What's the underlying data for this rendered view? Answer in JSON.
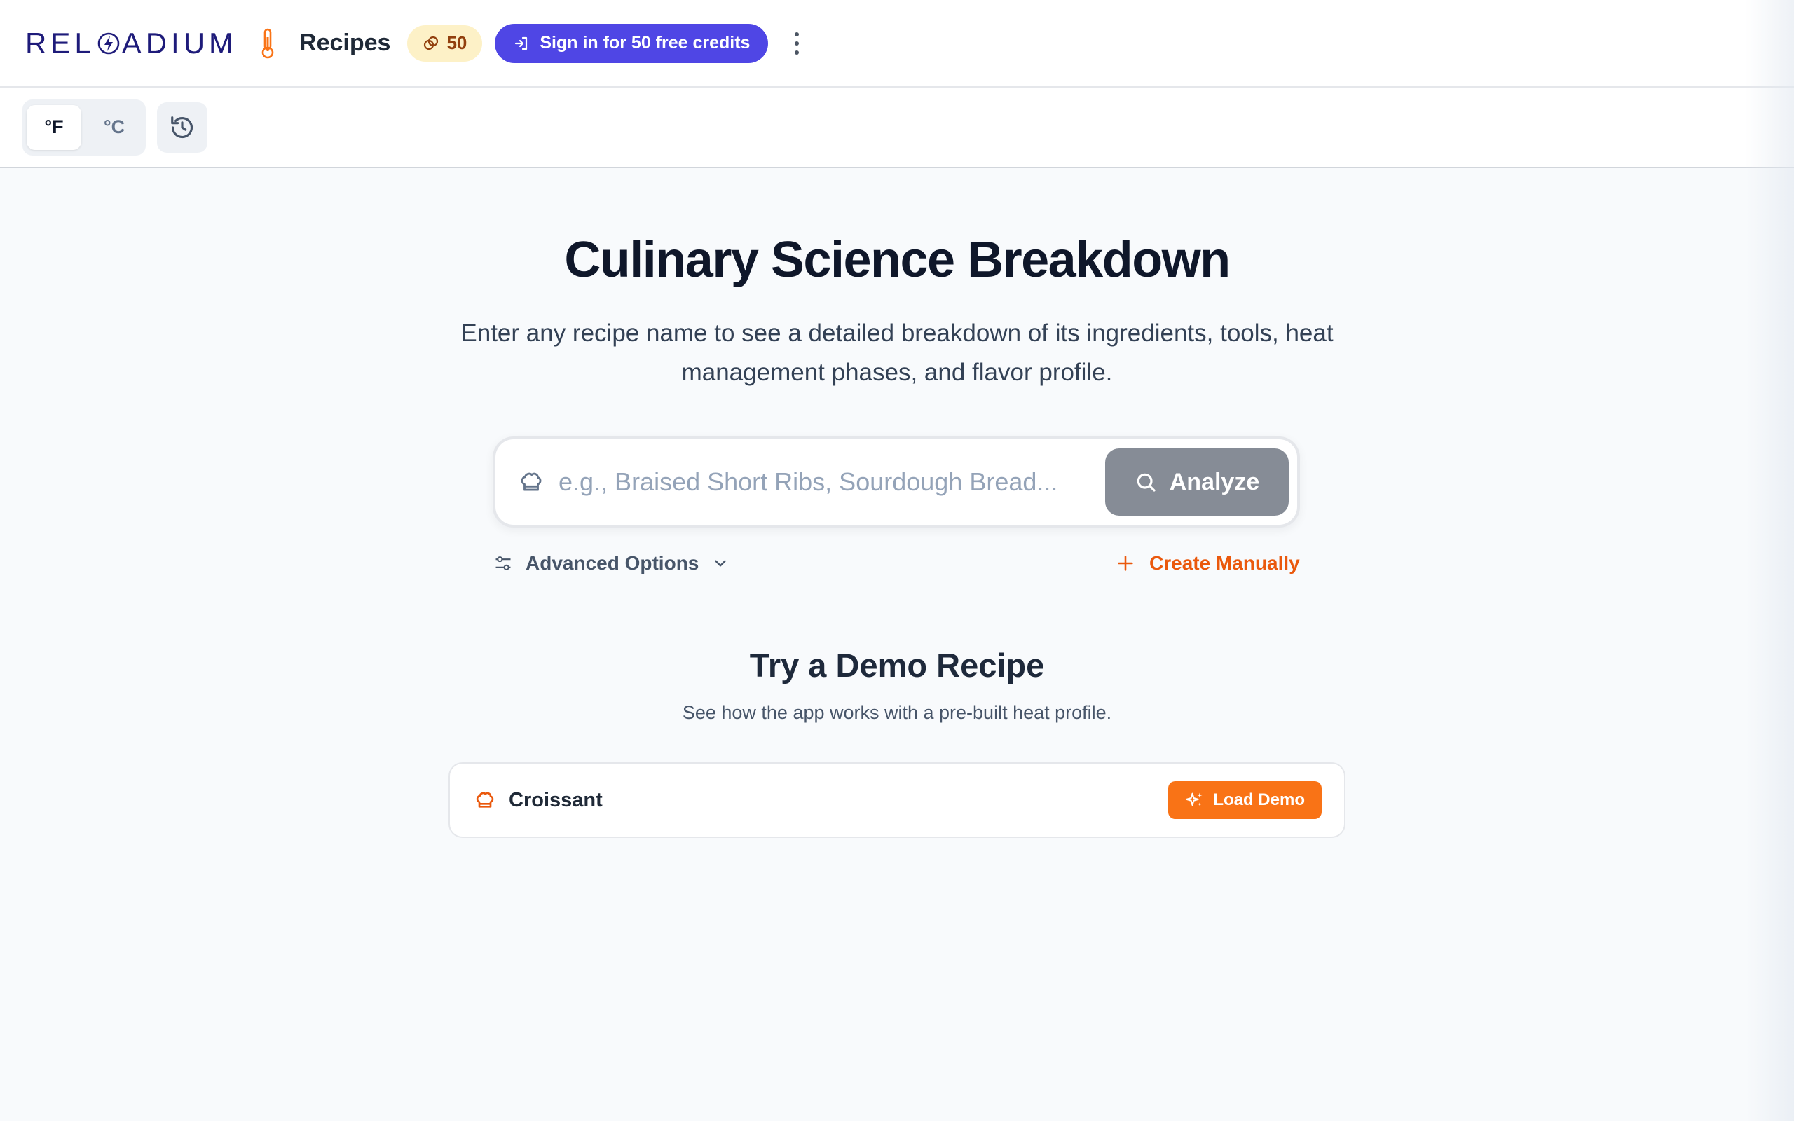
{
  "header": {
    "logo_text_left": "REL",
    "logo_text_right": "ADIUM",
    "app_title": "Recipes",
    "credits": "50",
    "signin_label": "Sign in for 50 free credits",
    "more_icon": "kebab-icon"
  },
  "toolbar": {
    "unit_f": "°F",
    "unit_c": "°C",
    "active_unit": "°F",
    "history_icon": "history-icon"
  },
  "hero": {
    "title": "Culinary Science Breakdown",
    "subtitle": "Enter any recipe name to see a detailed breakdown of its ingredients, tools, heat management phases, and flavor profile."
  },
  "search": {
    "value": "",
    "placeholder": "e.g., Braised Short Ribs, Sourdough Bread...",
    "analyze_label": "Analyze"
  },
  "options": {
    "advanced_label": "Advanced Options",
    "create_manual_label": "Create Manually"
  },
  "demo": {
    "title": "Try a Demo Recipe",
    "subtitle": "See how the app works with a pre-built heat profile.",
    "items": [
      {
        "name": "Croissant",
        "button_label": "Load Demo"
      }
    ]
  },
  "colors": {
    "brand_indigo": "#4f46e5",
    "accent_orange": "#f97316",
    "credits_bg": "#fdf1c7",
    "analyze_disabled": "#868c96"
  }
}
